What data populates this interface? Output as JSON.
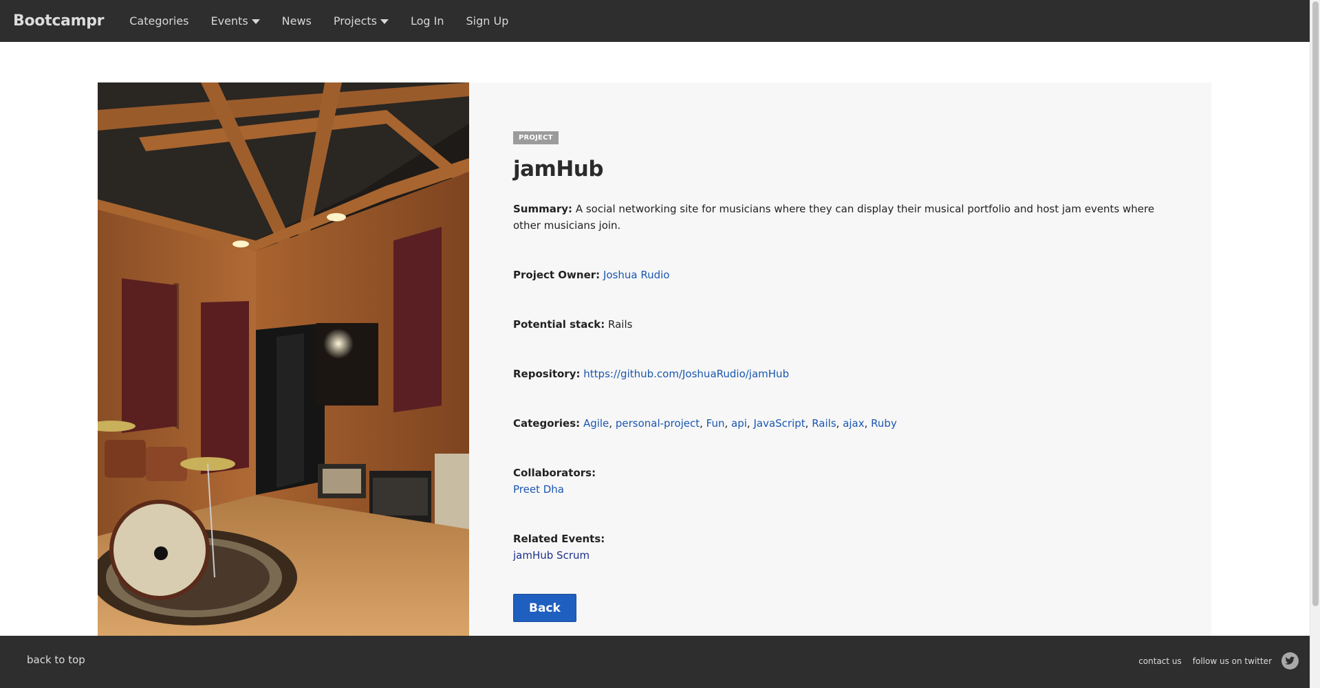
{
  "nav": {
    "brand": "Bootcampr",
    "items": [
      {
        "label": "Categories"
      },
      {
        "label": "Events"
      },
      {
        "label": "News"
      },
      {
        "label": "Projects"
      },
      {
        "label": "Log In"
      },
      {
        "label": "Sign Up"
      }
    ]
  },
  "project": {
    "badge": "PROJECT",
    "title": "jamHub",
    "summary_label": "Summary:",
    "summary": "A social networking site for musicians where they can display their musical portfolio and host jam events where other musicians join.",
    "owner_label": "Project Owner:",
    "owner": "Joshua Rudio",
    "stack_label": "Potential stack:",
    "stack": "Rails",
    "repo_label": "Repository:",
    "repo": "https://github.com/JoshuaRudio/jamHub",
    "categories_label": "Categories:",
    "categories": [
      "Agile",
      "personal-project",
      "Fun",
      "api",
      "JavaScript",
      "Rails",
      "ajax",
      "Ruby"
    ],
    "collaborators_label": "Collaborators:",
    "collaborators": [
      "Preet Dha"
    ],
    "events_label": "Related Events:",
    "events": [
      "jamHub Scrum"
    ],
    "back_label": "Back"
  },
  "footer": {
    "back_to_top": "back to top",
    "contact": "contact us",
    "twitter": "follow us on twitter"
  },
  "colors": {
    "navbar_bg": "#2e2e2e",
    "link": "#1a56b0",
    "button": "#1f5fbf",
    "panel_bg": "#f7f7f7"
  }
}
